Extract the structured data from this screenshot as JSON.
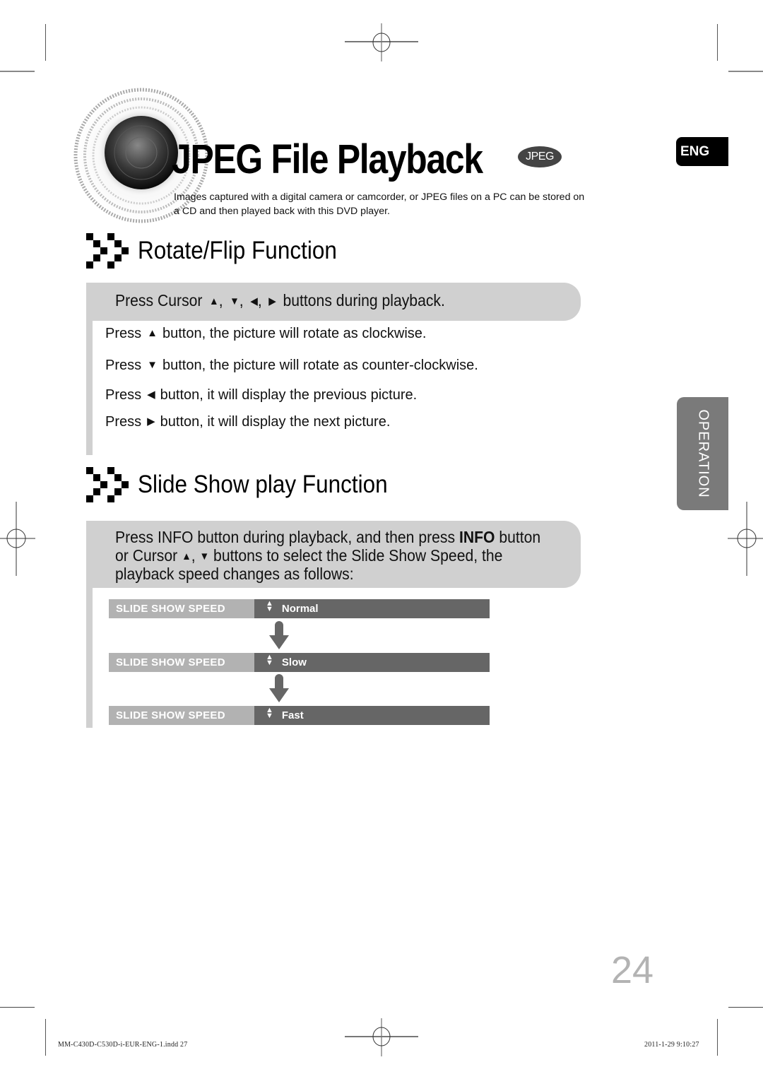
{
  "header": {
    "title": "JPEG File Playback",
    "badge": "JPEG",
    "intro": "Images captured with a digital camera or camcorder, or JPEG files on a PC can be stored on a CD and then played back with this DVD player.",
    "disc_icon": "speaker-disc-icon"
  },
  "side_tabs": {
    "language": "ENG",
    "chapter": "OPERATION"
  },
  "rotate_section": {
    "icon": "double-chevron-icon",
    "title": "Rotate/Flip Function",
    "instruction": {
      "prefix": "Press Cursor",
      "symbols": [
        "▲",
        "▼",
        "◀",
        "▶"
      ],
      "suffix": "buttons during playback."
    },
    "lines": [
      {
        "press": "Press",
        "symbol": "▲",
        "text": "button, the picture will rotate as clockwise."
      },
      {
        "press": "Press",
        "symbol": "▼",
        "text": "button, the picture will rotate as counter-clockwise."
      },
      {
        "press": "Press",
        "symbol": "◀",
        "text": "button, it will display the previous picture."
      },
      {
        "press": "Press",
        "symbol": "▶",
        "text": "button, it will display the next picture."
      }
    ]
  },
  "slideshow_section": {
    "icon": "double-chevron-icon",
    "title": "Slide Show play Function",
    "instruction": {
      "line1_a": "Press INFO button during playback, and then press ",
      "line1_bold": "INFO",
      "line1_b": " button",
      "line2_a": "or Cursor ",
      "line2_sym1": "▲",
      "line2_sep": ", ",
      "line2_sym2": "▼",
      "line2_b": " buttons to select the Slide Show Speed,  the",
      "line3": "playback speed changes as follows:"
    },
    "speeds": [
      {
        "label": "SLIDE SHOW SPEED",
        "icon": "up-down-icon",
        "value": "Normal"
      },
      {
        "label": "SLIDE SHOW SPEED",
        "icon": "up-down-icon",
        "value": "Slow"
      },
      {
        "label": "SLIDE SHOW SPEED",
        "icon": "up-down-icon",
        "value": "Fast"
      }
    ]
  },
  "footer": {
    "page_number": "24",
    "file_slug": "MM-C430D-C530D-i-EUR-ENG-1.indd   27",
    "date_slug": "2011-1-29   9:10:27"
  },
  "colors": {
    "instruction_bar": "#d0d0d0",
    "speed_label_bg": "#b2b2b2",
    "speed_value_bg": "#666666",
    "operation_tab": "#7a7a7a",
    "page_number": "#b3b3b3"
  }
}
